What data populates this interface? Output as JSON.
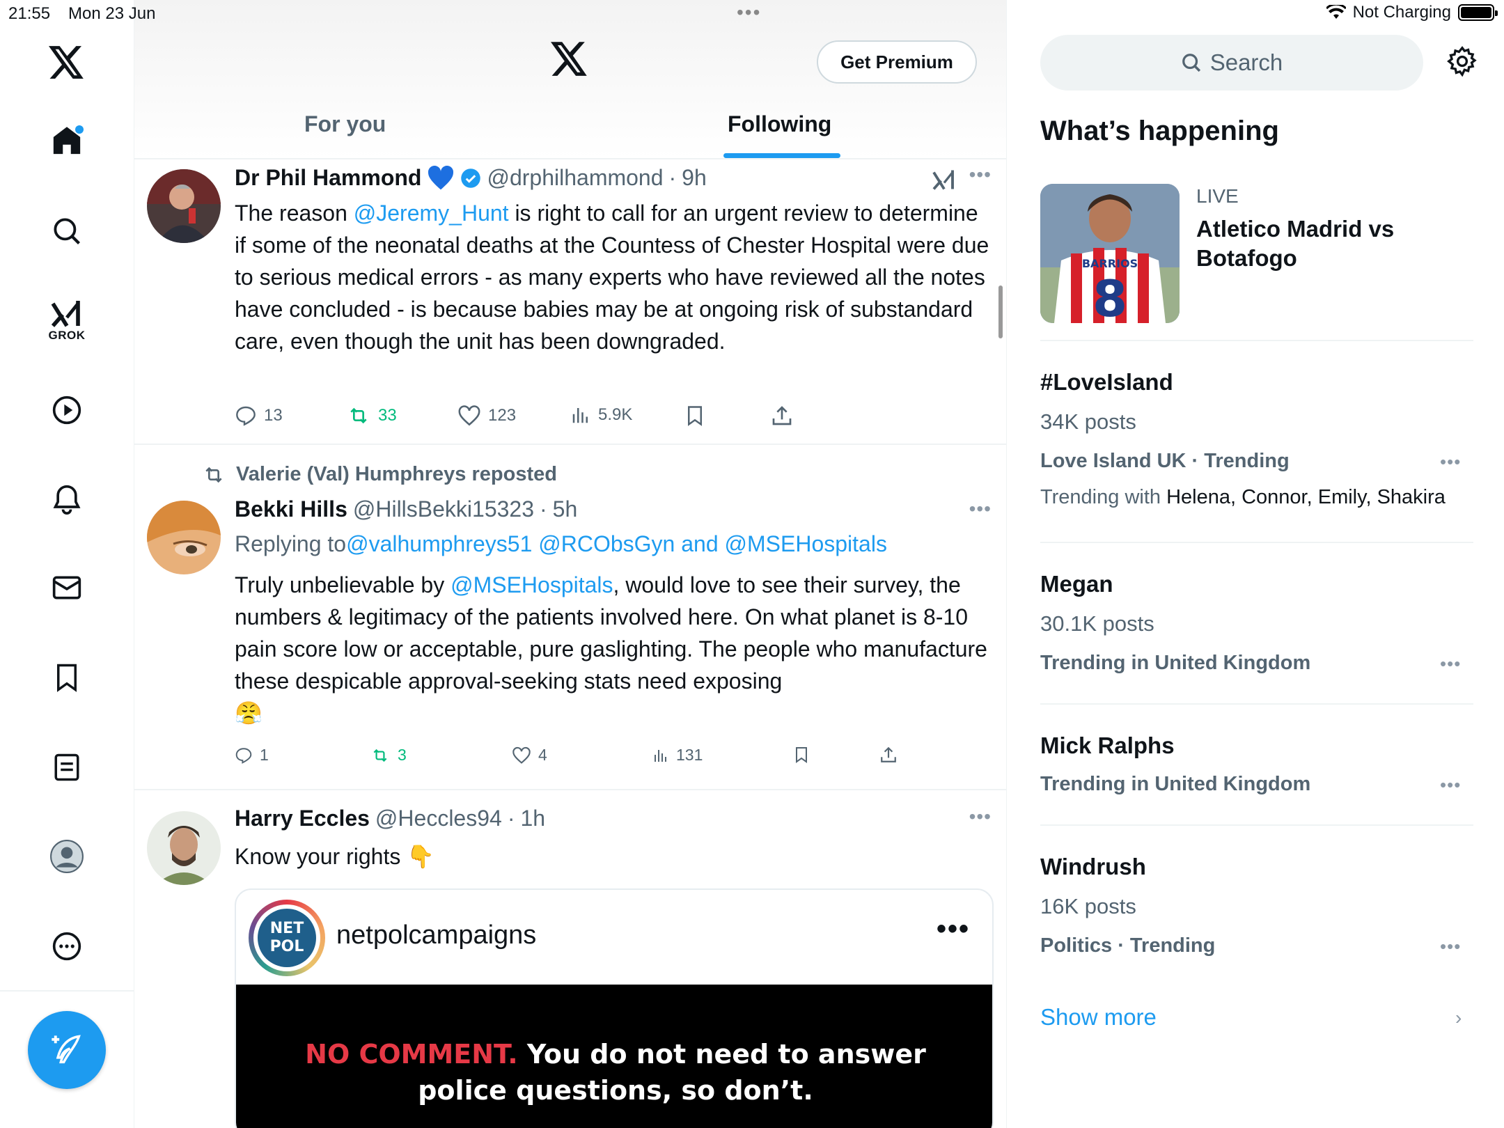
{
  "status_bar": {
    "time": "21:55",
    "date": "Mon 23 Jun",
    "charging": "Not Charging"
  },
  "nav": {
    "items": [
      "home-icon",
      "search-icon",
      "grok-icon",
      "video-icon",
      "bell-icon",
      "mail-icon",
      "bookmark-icon",
      "list-icon",
      "profile-icon",
      "more-icon"
    ],
    "grok_label": "GROK"
  },
  "header": {
    "premium_label": "Get Premium",
    "tabs": [
      {
        "label": "For you",
        "active": false
      },
      {
        "label": "Following",
        "active": true
      }
    ]
  },
  "tweets": [
    {
      "name": "Dr Phil Hammond",
      "handle": "@drphilhammond",
      "sep": "·",
      "time": "9h",
      "body_before": "The reason ",
      "body_mention": "@Jeremy_Hunt",
      "body_after": " is right to call for an urgent review to determine if some of the neonatal deaths at the Countess of Chester Hospital were due to serious medical errors - as many experts who have reviewed all the notes have concluded - is because babies may be at ongoing risk of substandard care, even though the unit has been downgraded.",
      "replies": "13",
      "reposts": "33",
      "likes": "123",
      "views": "5.9K"
    },
    {
      "repost_label": "Valerie (Val) Humphreys reposted",
      "name": "Bekki Hills",
      "handle": "@HillsBekki15323",
      "sep": "·",
      "time": "5h",
      "replying_prefix": "Replying to ",
      "replying_to": "@valhumphreys51 @RCObsGyn and @MSEHospitals",
      "body_before": "Truly unbelievable by ",
      "body_mention": "@MSEHospitals",
      "body_after": ", would love to see their survey, the numbers & legitimacy of the patients involved here. On what planet is 8-10 pain score low or acceptable, pure gaslighting. The people who manufacture these despicable approval-seeking stats need exposing",
      "emoji": "😤",
      "replies": "1",
      "reposts": "3",
      "likes": "4",
      "views": "131"
    },
    {
      "name": "Harry Eccles",
      "handle": "@Heccles94",
      "sep": "·",
      "time": "1h",
      "body": "Know your rights",
      "emoji": "👇",
      "card": {
        "logo_line1": "NET",
        "logo_line2": "POL",
        "name": "netpolcampaigns",
        "media_red": "NO COMMENT.",
        "media_line1": " You do not need to answer",
        "media_line2": "police questions, so don’t."
      }
    }
  ],
  "sidebar": {
    "search_placeholder": "Search",
    "title": "What’s happening",
    "live": {
      "label": "LIVE",
      "title": "Atletico Madrid vs Botafogo",
      "jersey_name": "BARRIOS",
      "jersey_number": "8"
    },
    "trends": [
      {
        "title": "#LoveIsland",
        "posts": "34K posts",
        "meta": "Love Island UK · Trending",
        "with_label": "Trending with ",
        "with_names": "Helena, Connor, Emily, Shakira"
      },
      {
        "title": "Megan",
        "posts": "30.1K posts",
        "meta": "Trending in United Kingdom"
      },
      {
        "title": "Mick Ralphs",
        "meta": "Trending in United Kingdom"
      },
      {
        "title": "Windrush",
        "posts": "16K posts",
        "meta": "Politics · Trending"
      }
    ],
    "show_more": "Show more"
  },
  "colors": {
    "accent": "#1d9bf0",
    "repost_green": "#00ba7c",
    "secondary_text": "#536471"
  }
}
